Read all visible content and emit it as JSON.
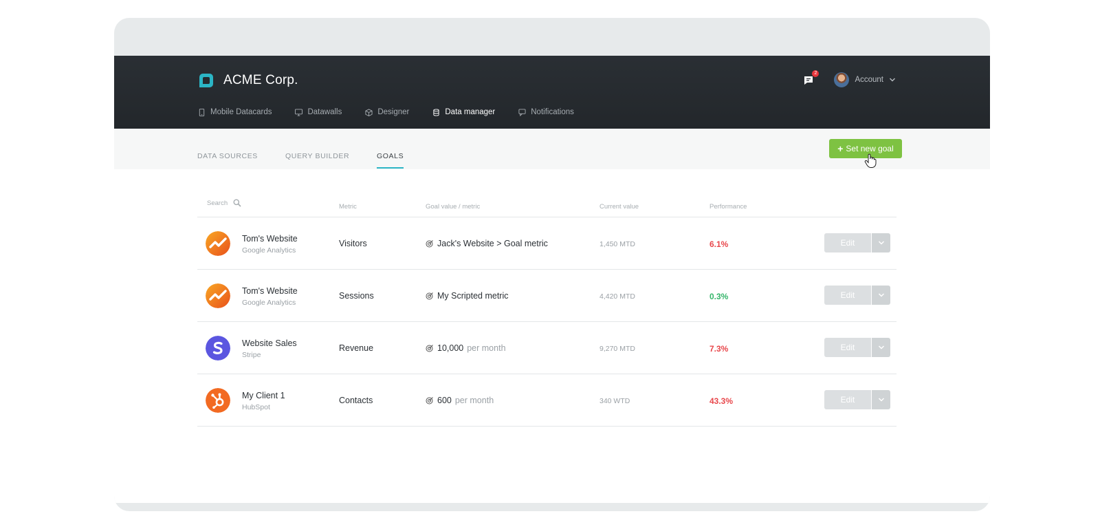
{
  "brand": {
    "name": "ACME Corp.",
    "accent": "#2bb5c5"
  },
  "nav": {
    "items": [
      {
        "label": "Mobile Datacards",
        "icon": "mobile-icon"
      },
      {
        "label": "Datawalls",
        "icon": "monitor-icon"
      },
      {
        "label": "Designer",
        "icon": "box-icon"
      },
      {
        "label": "Data manager",
        "icon": "database-icon",
        "active": true
      },
      {
        "label": "Notifications",
        "icon": "notification-icon"
      }
    ]
  },
  "header": {
    "notification_count": "2",
    "account_label": "Account"
  },
  "subtabs": [
    {
      "label": "DATA SOURCES"
    },
    {
      "label": "QUERY BUILDER"
    },
    {
      "label": "GOALS",
      "active": true
    }
  ],
  "cta": {
    "label": "Set new goal",
    "color": "#7ec242"
  },
  "table": {
    "search_placeholder": "Search",
    "columns": {
      "metric": "Metric",
      "goal": "Goal value / metric",
      "current": "Current value",
      "performance": "Performance"
    },
    "edit_label": "Edit",
    "rows": [
      {
        "source": "Tom's Website",
        "provider": "Google Analytics",
        "logo": "google-analytics-icon",
        "metric": "Visitors",
        "goal_value": "Jack's Website > Goal metric",
        "goal_period": "",
        "current": "1,450 MTD",
        "performance": "6.1%",
        "status": "negative"
      },
      {
        "source": "Tom's Website",
        "provider": "Google Analytics",
        "logo": "google-analytics-icon",
        "metric": "Sessions",
        "goal_value": "My Scripted metric",
        "goal_period": "",
        "current": "4,420 MTD",
        "performance": "0.3%",
        "status": "positive"
      },
      {
        "source": "Website Sales",
        "provider": "Stripe",
        "logo": "stripe-icon",
        "metric": "Revenue",
        "goal_value": "10,000",
        "goal_period": "per month",
        "current": "9,270 MTD",
        "performance": "7.3%",
        "status": "negative"
      },
      {
        "source": "My Client 1",
        "provider": "HubSpot",
        "logo": "hubspot-icon",
        "metric": "Contacts",
        "goal_value": "600",
        "goal_period": "per month",
        "current": "340 WTD",
        "performance": "43.3%",
        "status": "negative"
      }
    ]
  },
  "colors": {
    "negative": "#e8474b",
    "positive": "#35b56a"
  }
}
